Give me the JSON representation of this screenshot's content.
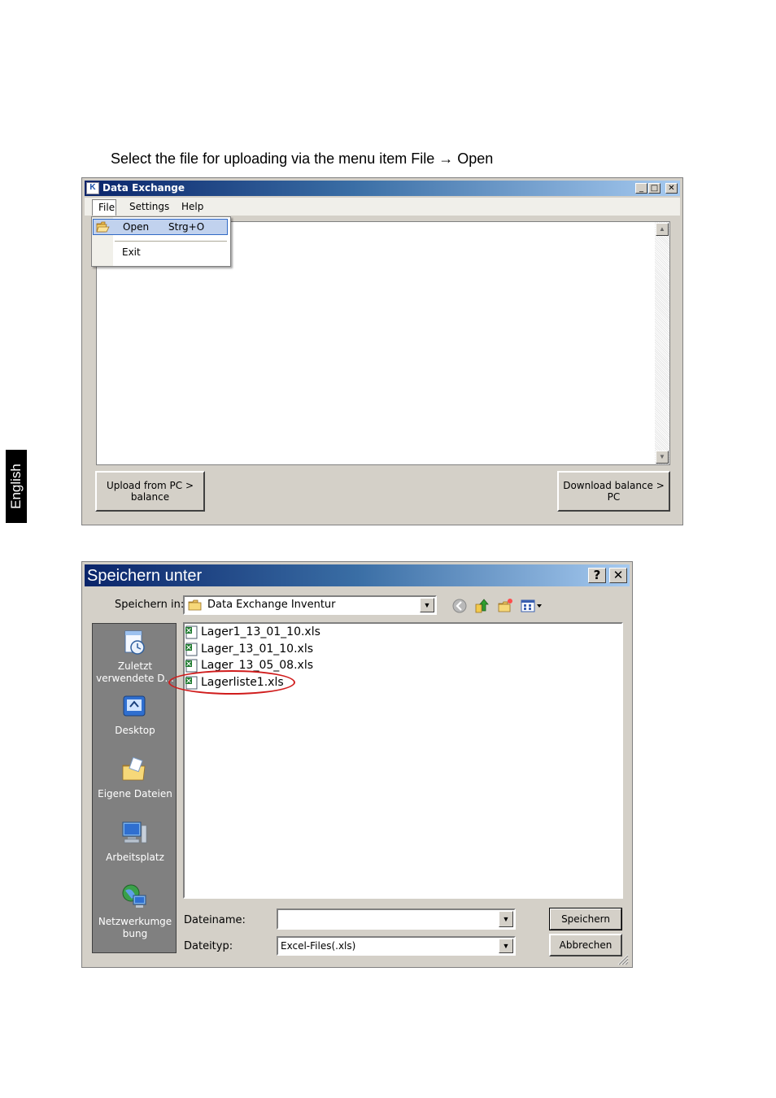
{
  "instruction": "Select the file for uploading via the menu item File → Open",
  "side_tab": "English",
  "data_exchange": {
    "title": "Data Exchange",
    "caption_buttons": {
      "minimize": "_",
      "maximize": "□",
      "close": "✕"
    },
    "menu": {
      "file": "File",
      "settings": "Settings",
      "help": "Help"
    },
    "file_menu": {
      "open": "Open",
      "open_shortcut": "Strg+O",
      "exit": "Exit"
    },
    "scroll": {
      "up": "▲",
      "down": "▼"
    },
    "buttons": {
      "upload_line1": "Upload from PC >",
      "upload_line2": "balance",
      "download_line1": "Download balance >",
      "download_line2": "PC"
    }
  },
  "save_dialog": {
    "title": "Speichern unter",
    "caption_buttons": {
      "help": "?",
      "close": "✕"
    },
    "save_in_label": "Speichern in:",
    "save_in_value": "Data Exchange Inventur",
    "dropdown_arrow": "▼",
    "places": [
      {
        "line1": "Zuletzt",
        "line2": "verwendete D...",
        "icon": "recent-documents-icon"
      },
      {
        "line1": "Desktop",
        "line2": "",
        "icon": "desktop-icon"
      },
      {
        "line1": "Eigene Dateien",
        "line2": "",
        "icon": "my-documents-icon"
      },
      {
        "line1": "Arbeitsplatz",
        "line2": "",
        "icon": "my-computer-icon"
      },
      {
        "line1": "Netzwerkumge",
        "line2": "bung",
        "icon": "network-places-icon"
      }
    ],
    "files": [
      "Lager1_13_01_10.xls",
      "Lager_13_01_10.xls",
      "Lager_13_05_08.xls",
      "Lagerliste1.xls"
    ],
    "filename_label": "Dateiname:",
    "filename_value": "",
    "filetype_label": "Dateityp:",
    "filetype_value": "Excel-Files(.xls)",
    "save_button": "Speichern",
    "cancel_button": "Abbrechen",
    "highlight_color": "#d01c1c"
  }
}
